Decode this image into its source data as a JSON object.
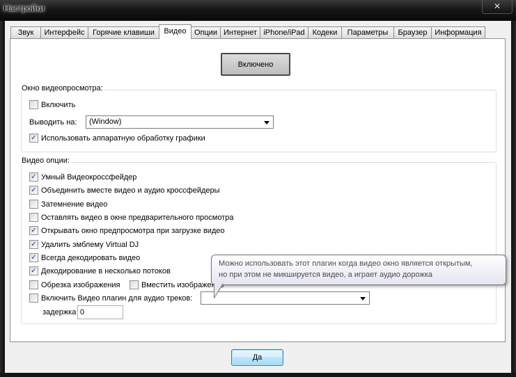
{
  "window": {
    "title": "Настройки",
    "close_glyph": "✕"
  },
  "tabs": [
    "Звук",
    "Интерфейс",
    "Горячие клавиши",
    "Видео",
    "Опции",
    "Интернет",
    "iPhone/iPad",
    "Кодеки",
    "Параметры",
    "Браузер",
    "Информация"
  ],
  "active_tab": "Видео",
  "enable_button": "Включено",
  "preview_group": {
    "label": "Окно видеопросмотра:",
    "enable_label": "Включить",
    "enable_checked": false,
    "output_label": "Выводить на:",
    "output_value": "(Window)",
    "hw_label": "Использовать аппаратную обработку графики",
    "hw_checked": true
  },
  "video_options": {
    "label": "Видео опции:",
    "items": [
      {
        "label": "Умный Видеокроссфейдер",
        "checked": true
      },
      {
        "label": "Объединить вместе видео и аудио кроссфейдеры",
        "checked": true
      },
      {
        "label": "Затемнение видео",
        "checked": false
      },
      {
        "label": "Оставлять видео в окне предварительного просмотра",
        "checked": false
      },
      {
        "label": "Открывать окно предпросмотра при загрузке видео",
        "checked": true
      },
      {
        "label": "Удалить эмблему Virtual DJ",
        "checked": true
      },
      {
        "label": "Всегда декодировать видео",
        "checked": true
      },
      {
        "label": "Декодирование в несколько потоков",
        "checked": true
      }
    ],
    "crop_label": "Обрезка изображения",
    "crop_checked": false,
    "fit_label": "Вместить изображение",
    "fit_checked": false,
    "plugin_label": "Включить Видео плагин для аудио треков:",
    "plugin_checked": false,
    "plugin_value": "",
    "delay_label": "задержка",
    "delay_value": "0"
  },
  "tooltip": {
    "line1": "Можно использовать этот плагин когда видео окно является открытым,",
    "line2": "но при этом не микшируется видео, а играет аудио дорожка"
  },
  "ok_button": "Да"
}
